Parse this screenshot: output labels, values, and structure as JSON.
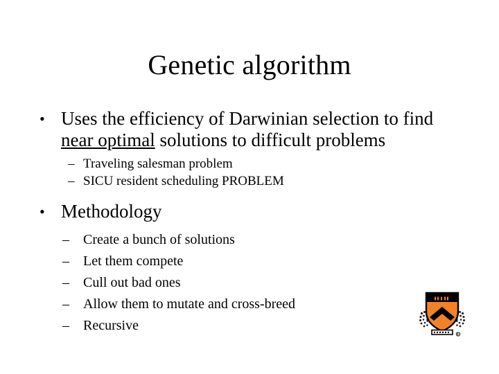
{
  "slide": {
    "title": "Genetic algorithm",
    "background_color": "#FFFFFF",
    "text_color": "#000000",
    "bullet_glyph": "•",
    "dash_glyph": "–",
    "content": [
      {
        "level": 1,
        "bullet": "•",
        "text_before": "Uses the efficiency of Darwinian selection to find ",
        "underlined_text": "near optimal",
        "text_after": " solutions to difficult problems"
      },
      {
        "level": 2,
        "bullet": "–",
        "text": "Traveling salesman problem"
      },
      {
        "level": 2,
        "bullet": "–",
        "text": "SICU resident scheduling PROBLEM"
      },
      {
        "level": 1,
        "bullet": "•",
        "text": "Methodology"
      },
      {
        "level": 3,
        "bullet": "–",
        "text": "Create a bunch of solutions"
      },
      {
        "level": 3,
        "bullet": "–",
        "text": "Let them compete"
      },
      {
        "level": 3,
        "bullet": "–",
        "text": "Cull out bad ones"
      },
      {
        "level": 3,
        "bullet": "–",
        "text": "Allow them to mutate and cross-breed"
      },
      {
        "level": 3,
        "bullet": "–",
        "text": "Recursive"
      }
    ]
  },
  "logo": {
    "name": "princeton-shield-logo",
    "shield_color": "#F28226",
    "chevron_color": "#000000",
    "chief_color": "#000000",
    "outline_color": "#000000"
  }
}
